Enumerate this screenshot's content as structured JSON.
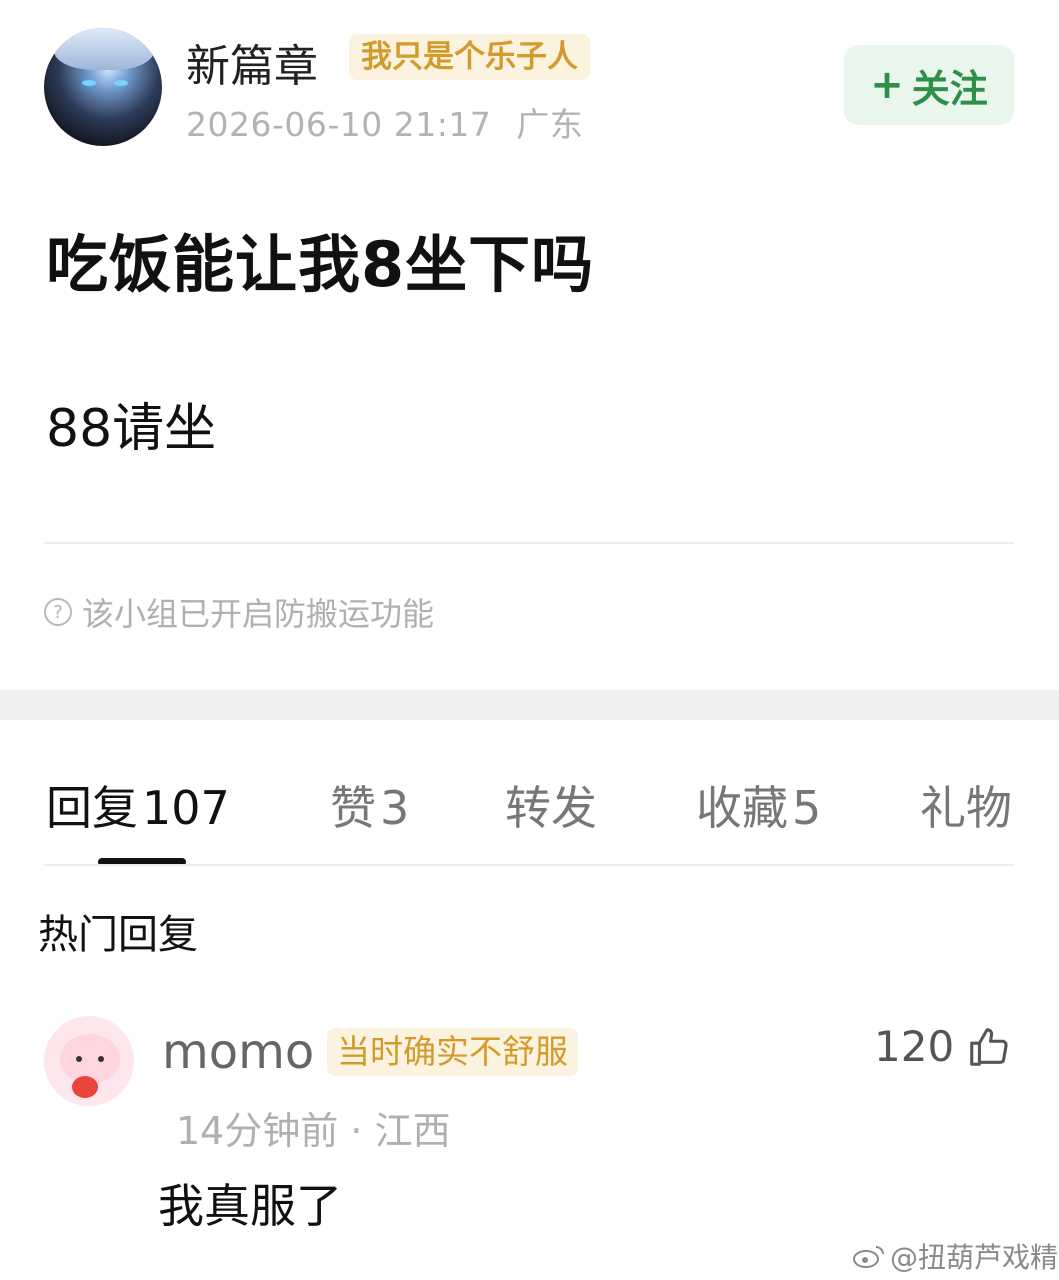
{
  "post": {
    "author": "新篇章",
    "author_tag": "我只是个乐子人",
    "timestamp": "2026-06-10 21:17",
    "location": "广东",
    "follow_label": "关注",
    "title": "吃饭能让我8坐下吗",
    "body": "88请坐",
    "notice": "该小组已开启防搬运功能"
  },
  "tabs": [
    {
      "label": "回复",
      "count": "107",
      "active": true
    },
    {
      "label": "赞",
      "count": "3",
      "active": false
    },
    {
      "label": "转发",
      "count": "",
      "active": false
    },
    {
      "label": "收藏",
      "count": "5",
      "active": false
    },
    {
      "label": "礼物",
      "count": "",
      "active": false
    }
  ],
  "hot_replies": {
    "title": "热门回复",
    "items": [
      {
        "user": "momo",
        "tag": "当时确实不舒服",
        "time": "14分钟前",
        "location": "江西",
        "meta": "14分钟前 · 江西",
        "text": "我真服了",
        "likes": "120"
      }
    ]
  },
  "watermark": "@扭葫芦戏精",
  "icons": {
    "follow": "plus-icon",
    "notice": "question-circle-icon",
    "like": "thumbs-up-icon",
    "watermark": "weibo-icon"
  },
  "colors": {
    "tag_bg": "#fbf3df",
    "tag_text": "#d39b2c",
    "follow_bg": "#e9f6ec",
    "follow_text": "#2f8f4a"
  }
}
